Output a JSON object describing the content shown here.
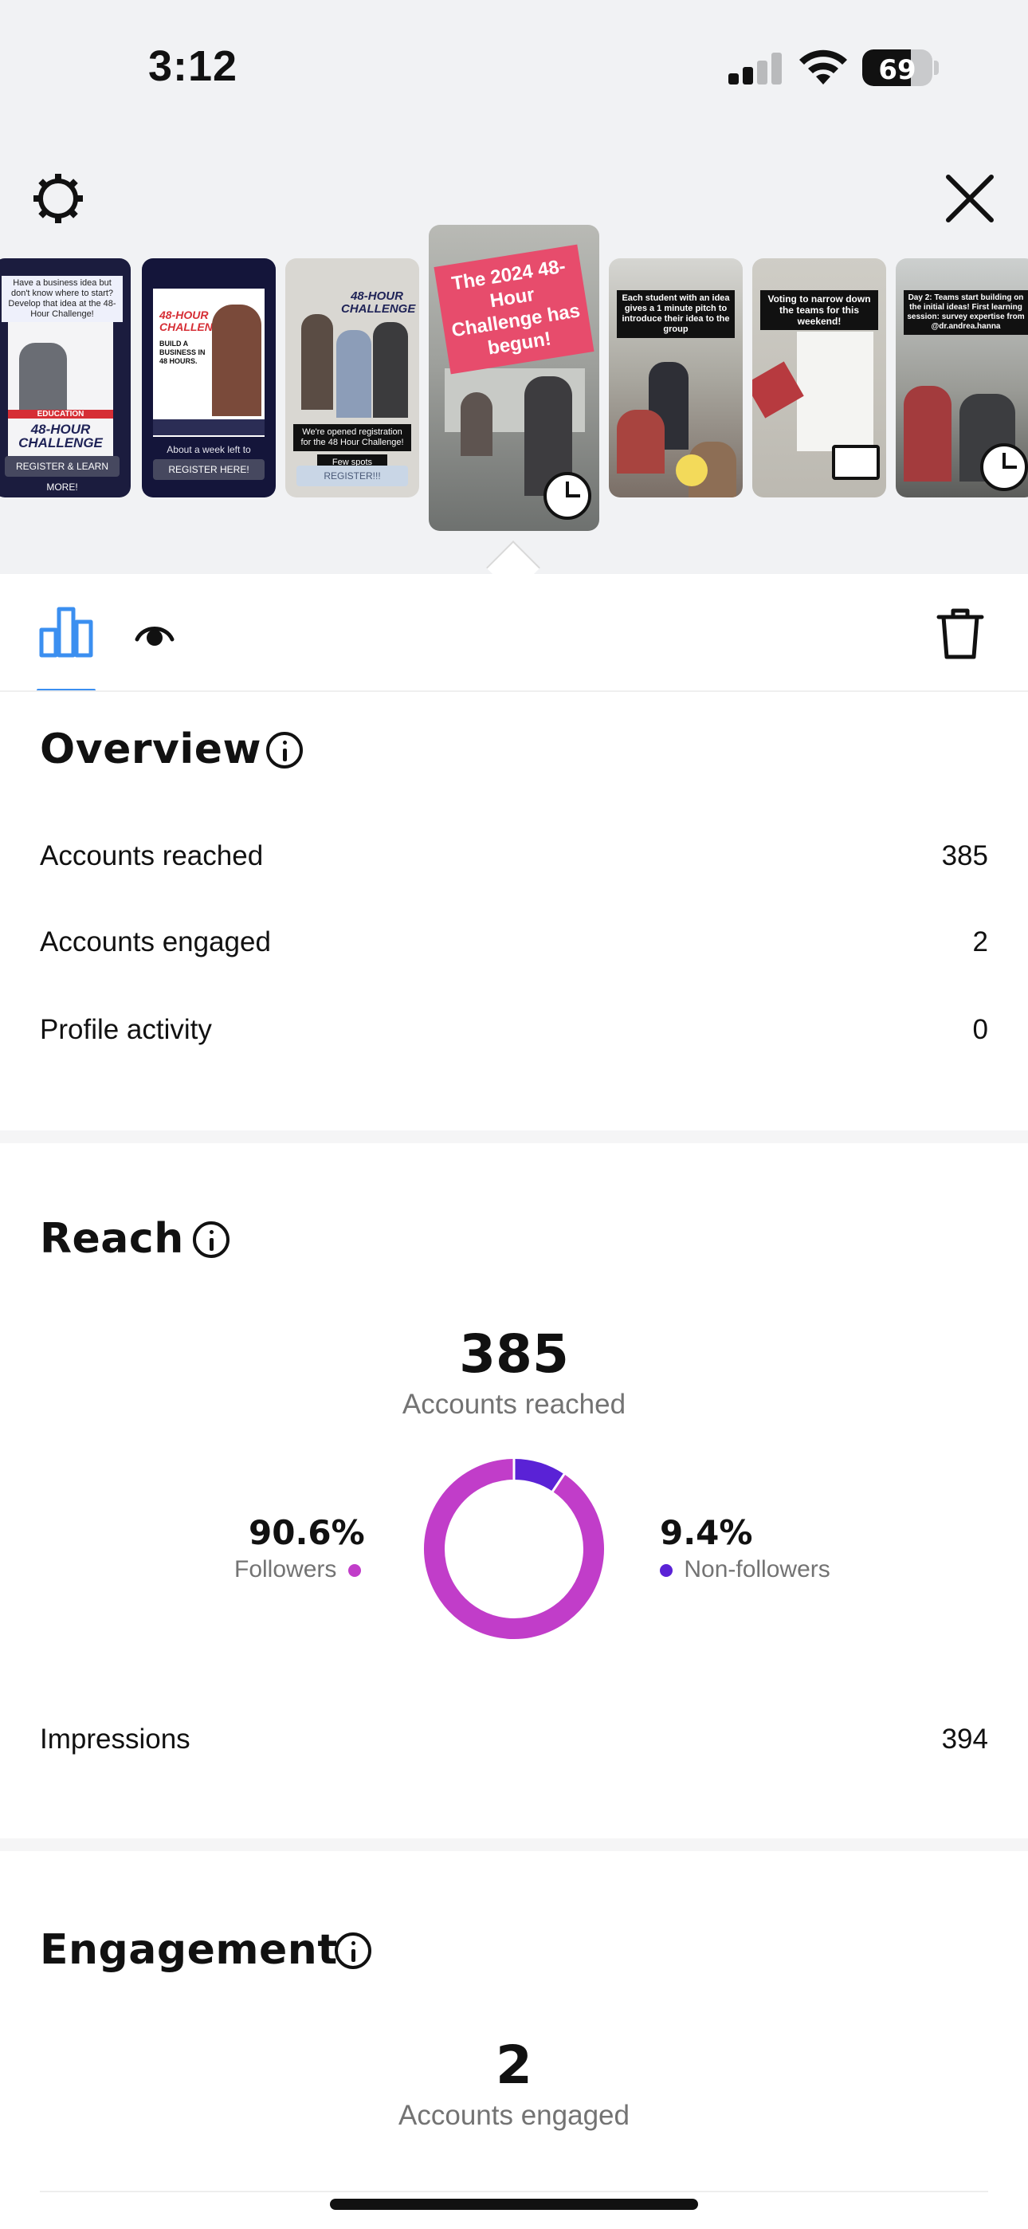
{
  "status_bar": {
    "time": "3:12",
    "battery": "69",
    "battery_level": 0.69,
    "signal_bars_active": 2
  },
  "header": {
    "settings_icon": "gear-icon",
    "close_icon": "close-icon"
  },
  "stories": [
    {
      "id": "s1",
      "caption": "Have a business idea but don't know where to start? Develop that idea at the 48-Hour Challenge!",
      "headline": "48-HOUR CHALLENGE",
      "button": "REGISTER & LEARN MORE!"
    },
    {
      "id": "s2",
      "headline": "48-HOUR CHALLENGE",
      "sub": "BUILD A BUSINESS IN 48 HOURS.",
      "caption": "About a week left to register!",
      "button": "REGISTER HERE!"
    },
    {
      "id": "s3",
      "headline": "48-HOUR CHALLENGE",
      "caption": "We're opened registration for the 48 Hour Challenge!",
      "caption2": "Few spots remain!!",
      "button": "REGISTER!!!"
    },
    {
      "id": "s4",
      "caption": "The 2024 48-Hour Challenge has begun!",
      "selected": true
    },
    {
      "id": "s5",
      "caption": "Each student with an idea gives a 1 minute pitch to introduce their idea to the group"
    },
    {
      "id": "s6",
      "caption": "Voting to narrow down the teams for this weekend!"
    },
    {
      "id": "s7",
      "caption": "Day 2: Teams start building on the initial ideas! First learning session: survey expertise from @dr.andrea.hanna"
    }
  ],
  "tabs": {
    "insights_icon": "bar-chart-icon",
    "viewers_icon": "eye-icon",
    "delete_icon": "trash-icon"
  },
  "overview": {
    "title": "Overview",
    "rows": [
      {
        "label": "Accounts reached",
        "value": "385"
      },
      {
        "label": "Accounts engaged",
        "value": "2"
      },
      {
        "label": "Profile activity",
        "value": "0"
      }
    ]
  },
  "reach": {
    "title": "Reach",
    "total": "385",
    "total_label": "Accounts reached",
    "followers_pct": "90.6%",
    "followers_label": "Followers",
    "non_followers_pct": "9.4%",
    "non_followers_label": "Non-followers",
    "impressions_label": "Impressions",
    "impressions_value": "394",
    "colors": {
      "followers": "#c13dc9",
      "non_followers": "#5a22d6"
    }
  },
  "chart_data": {
    "type": "pie",
    "categories": [
      "Followers",
      "Non-followers"
    ],
    "values": [
      90.6,
      9.4
    ],
    "colors": [
      "#c13dc9",
      "#5a22d6"
    ]
  },
  "engagement": {
    "title": "Engagement",
    "total": "2",
    "total_label": "Accounts engaged"
  },
  "colors": {
    "accent": "#3b8ff0",
    "background_top": "#f1f2f4"
  }
}
